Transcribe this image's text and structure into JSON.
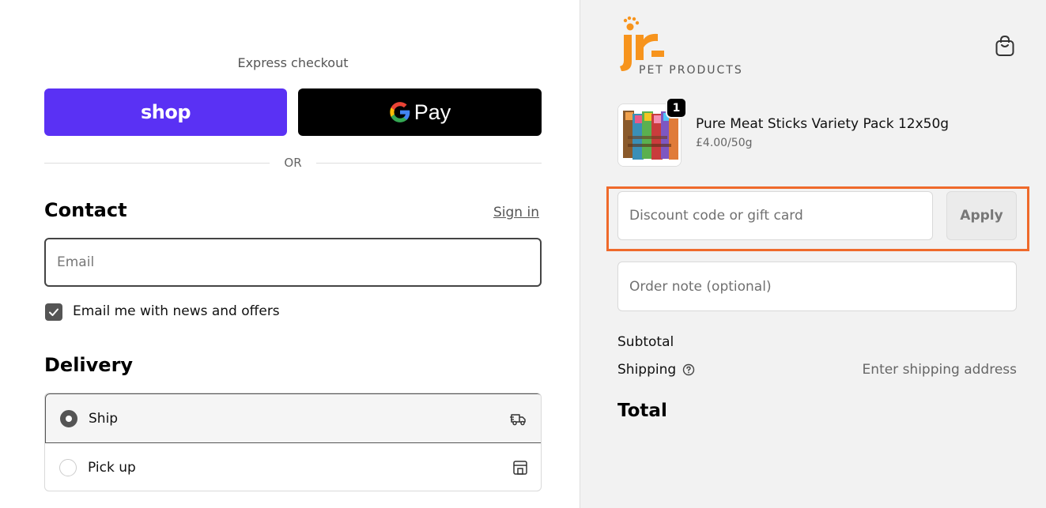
{
  "express": {
    "title": "Express checkout",
    "shop_label": "shop",
    "gpay_label": "Pay"
  },
  "divider": {
    "or": "OR"
  },
  "contact": {
    "heading": "Contact",
    "sign_in": "Sign in",
    "email_placeholder": "Email",
    "newsletter_label": "Email me with news and offers",
    "newsletter_checked": true
  },
  "delivery": {
    "heading": "Delivery",
    "options": [
      {
        "label": "Ship",
        "selected": true,
        "icon": "truck-icon"
      },
      {
        "label": "Pick up",
        "selected": false,
        "icon": "store-icon"
      }
    ]
  },
  "brand": {
    "logo_text": "jr",
    "tagline": "PET PRODUCTS",
    "color": "#f7941d"
  },
  "cart": {
    "quantity": "1",
    "product_name": "Pure Meat Sticks Variety Pack 12x50g",
    "product_price": "£4.00/50g"
  },
  "discount": {
    "placeholder": "Discount code or gift card",
    "apply_label": "Apply"
  },
  "note": {
    "placeholder": "Order note (optional)"
  },
  "summary": {
    "subtotal_label": "Subtotal",
    "shipping_label": "Shipping",
    "shipping_value": "Enter shipping address",
    "total_label": "Total"
  },
  "colors": {
    "shop_purple": "#5a31f4",
    "highlight_orange": "#ef6a2b"
  }
}
